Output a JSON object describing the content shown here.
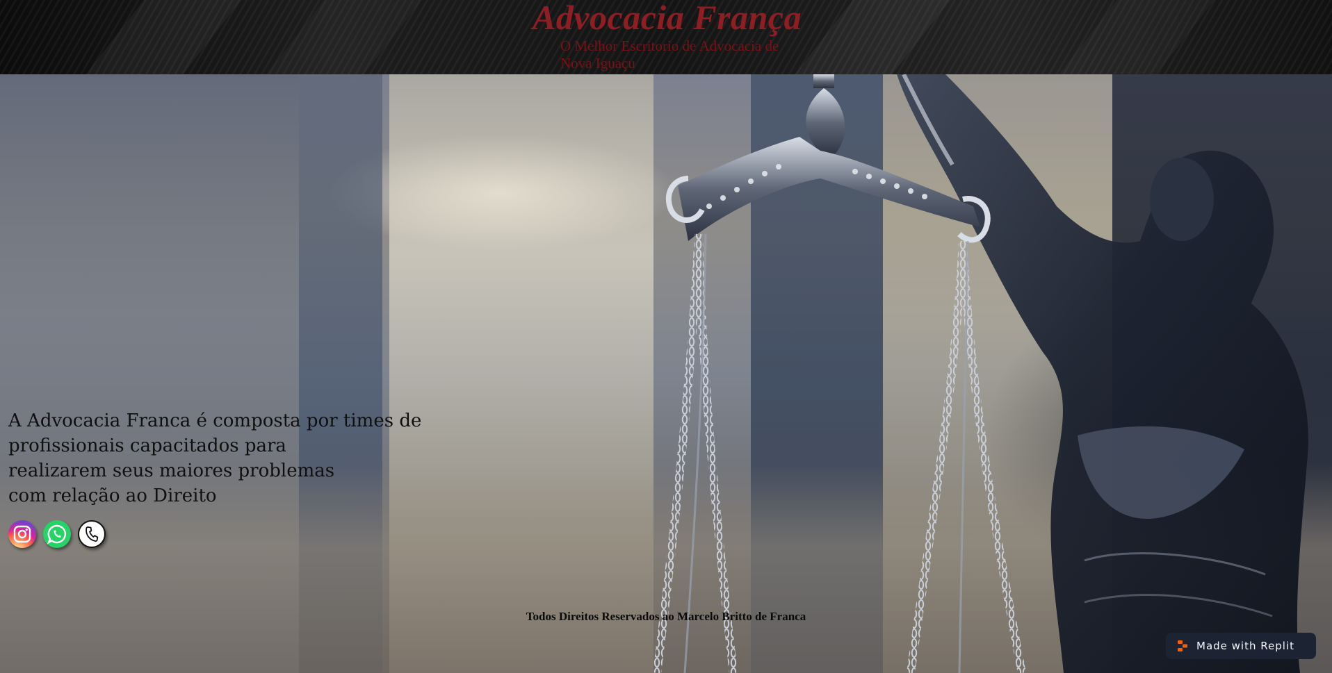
{
  "header": {
    "title": "Advocacia França",
    "subtitle": "O Melhor Escritorio de Advocacia de Nova Iguaçu"
  },
  "hero": {
    "description_lines": [
      "A Advocacia Franca é composta por times de",
      "profissionais capacitados para",
      "realizarem seus maiores problemas",
      "com relação ao Direito"
    ]
  },
  "social": [
    {
      "name": "instagram",
      "icon": "instagram-icon"
    },
    {
      "name": "whatsapp",
      "icon": "whatsapp-icon"
    },
    {
      "name": "phone",
      "icon": "phone-icon"
    }
  ],
  "footer": {
    "text": "Todos Direitos Reservados ao Marcelo Britto de Franca"
  },
  "badge": {
    "label": "Made with Replit",
    "icon": "replit-icon"
  },
  "colors": {
    "brand_red": "#8f1e24",
    "subtitle_red": "#7a1116",
    "header_bg": "#141414",
    "badge_bg": "#1c2333",
    "replit_orange": "#f26207"
  }
}
